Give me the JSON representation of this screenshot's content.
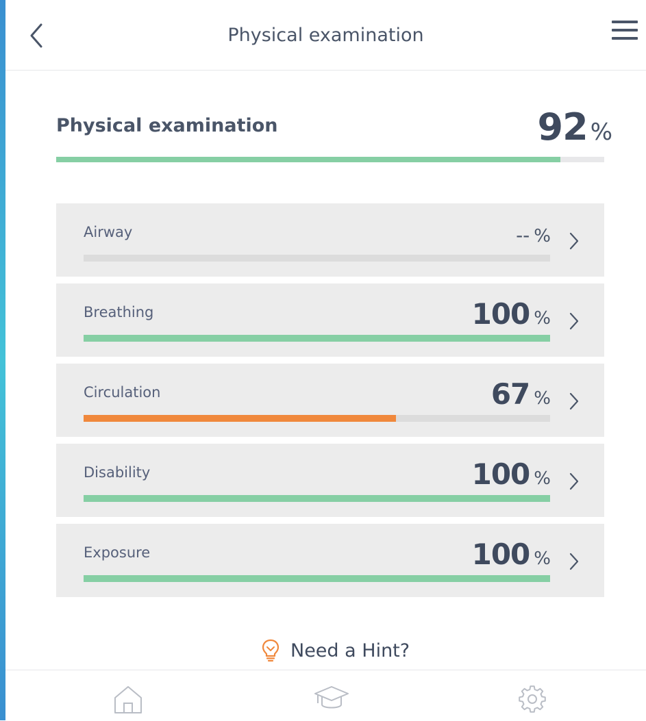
{
  "header": {
    "title": "Physical examination",
    "back_icon": "chevron-left-icon",
    "menu_icon": "hamburger-menu-icon"
  },
  "summary": {
    "title": "Physical examination",
    "score": "92",
    "unit": "%",
    "progress": 0.92,
    "color": "#86cfa4"
  },
  "categories": [
    {
      "label": "Airway",
      "score": "--",
      "unit": "%",
      "progress": 0,
      "color": "#86cfa4"
    },
    {
      "label": "Breathing",
      "score": "100",
      "unit": "%",
      "progress": 1.0,
      "color": "#86cfa4"
    },
    {
      "label": "Circulation",
      "score": "67",
      "unit": "%",
      "progress": 0.67,
      "color": "#f0883c"
    },
    {
      "label": "Disability",
      "score": "100",
      "unit": "%",
      "progress": 1.0,
      "color": "#86cfa4"
    },
    {
      "label": "Exposure",
      "score": "100",
      "unit": "%",
      "progress": 1.0,
      "color": "#86cfa4"
    }
  ],
  "hint": {
    "label": "Need a Hint?",
    "icon": "lightbulb-icon",
    "icon_color": "#f0883c"
  },
  "tabbar": {
    "items": [
      {
        "icon": "home-icon"
      },
      {
        "icon": "graduation-cap-icon"
      },
      {
        "icon": "gear-icon"
      }
    ]
  }
}
